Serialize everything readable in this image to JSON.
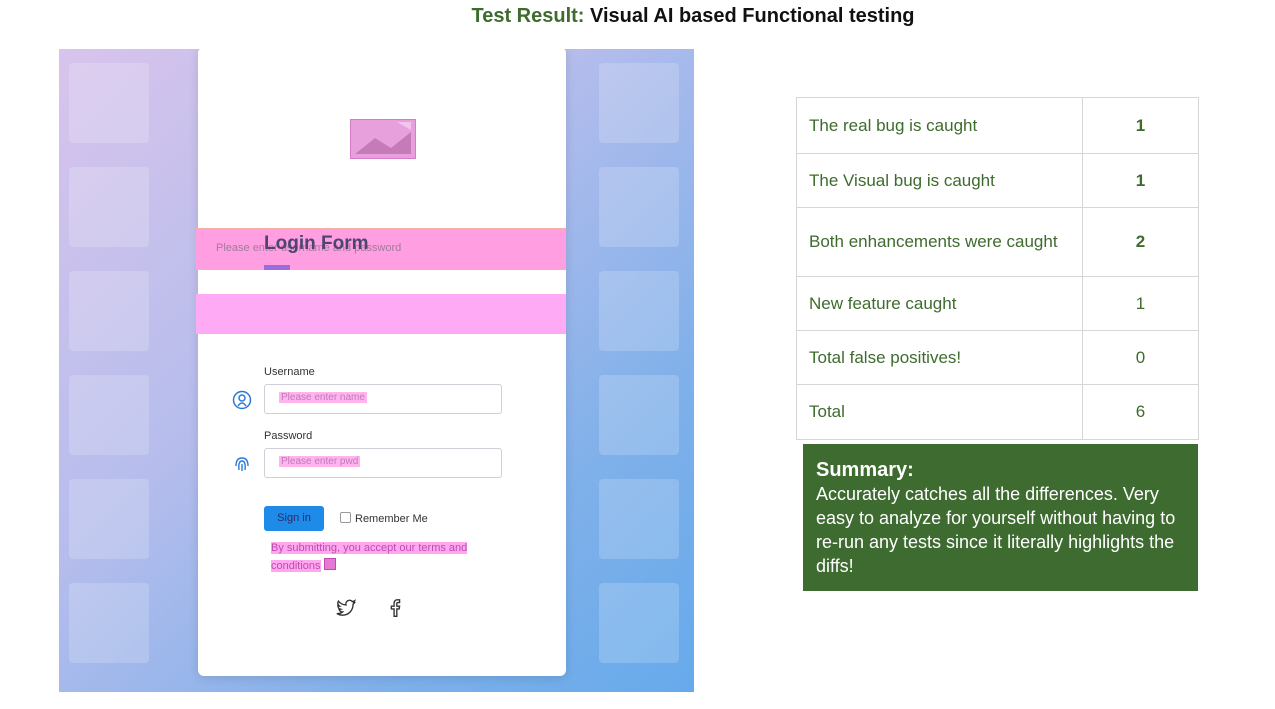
{
  "title": {
    "label": "Test Result:",
    "text": "Visual AI based Functional testing"
  },
  "screenshot": {
    "subtitle": "Please enter username and password",
    "form_title": "Login Form",
    "username_label": "Username",
    "username_placeholder": "Please enter name",
    "password_label": "Password",
    "password_placeholder": "Please enter pwd",
    "signin_label": "Sign in",
    "remember_label": "Remember Me",
    "terms_text": "By submitting, you accept our terms and conditions",
    "social_icons": [
      "twitter-icon",
      "facebook-icon"
    ],
    "highlight_color": "#ff9ee0",
    "button_color": "#1f8be8"
  },
  "results": [
    {
      "label": "The real bug is caught",
      "value": "1",
      "bold": true
    },
    {
      "label": "The Visual bug is caught",
      "value": "1",
      "bold": true
    },
    {
      "label": "Both enhancements were caught",
      "value": "2",
      "bold": true
    },
    {
      "label": "New feature caught",
      "value": "1",
      "bold": false
    },
    {
      "label": "Total false positives!",
      "value": "0",
      "bold": false
    },
    {
      "label": "Total",
      "value": "6",
      "bold": false
    }
  ],
  "summary": {
    "heading": "Summary:",
    "body": "Accurately catches all the differences. Very easy to analyze  for yourself without having to re-run any tests since it literally highlights the diffs!"
  },
  "colors": {
    "accent_green": "#3e6b2e",
    "summary_bg": "#3e6b30"
  }
}
